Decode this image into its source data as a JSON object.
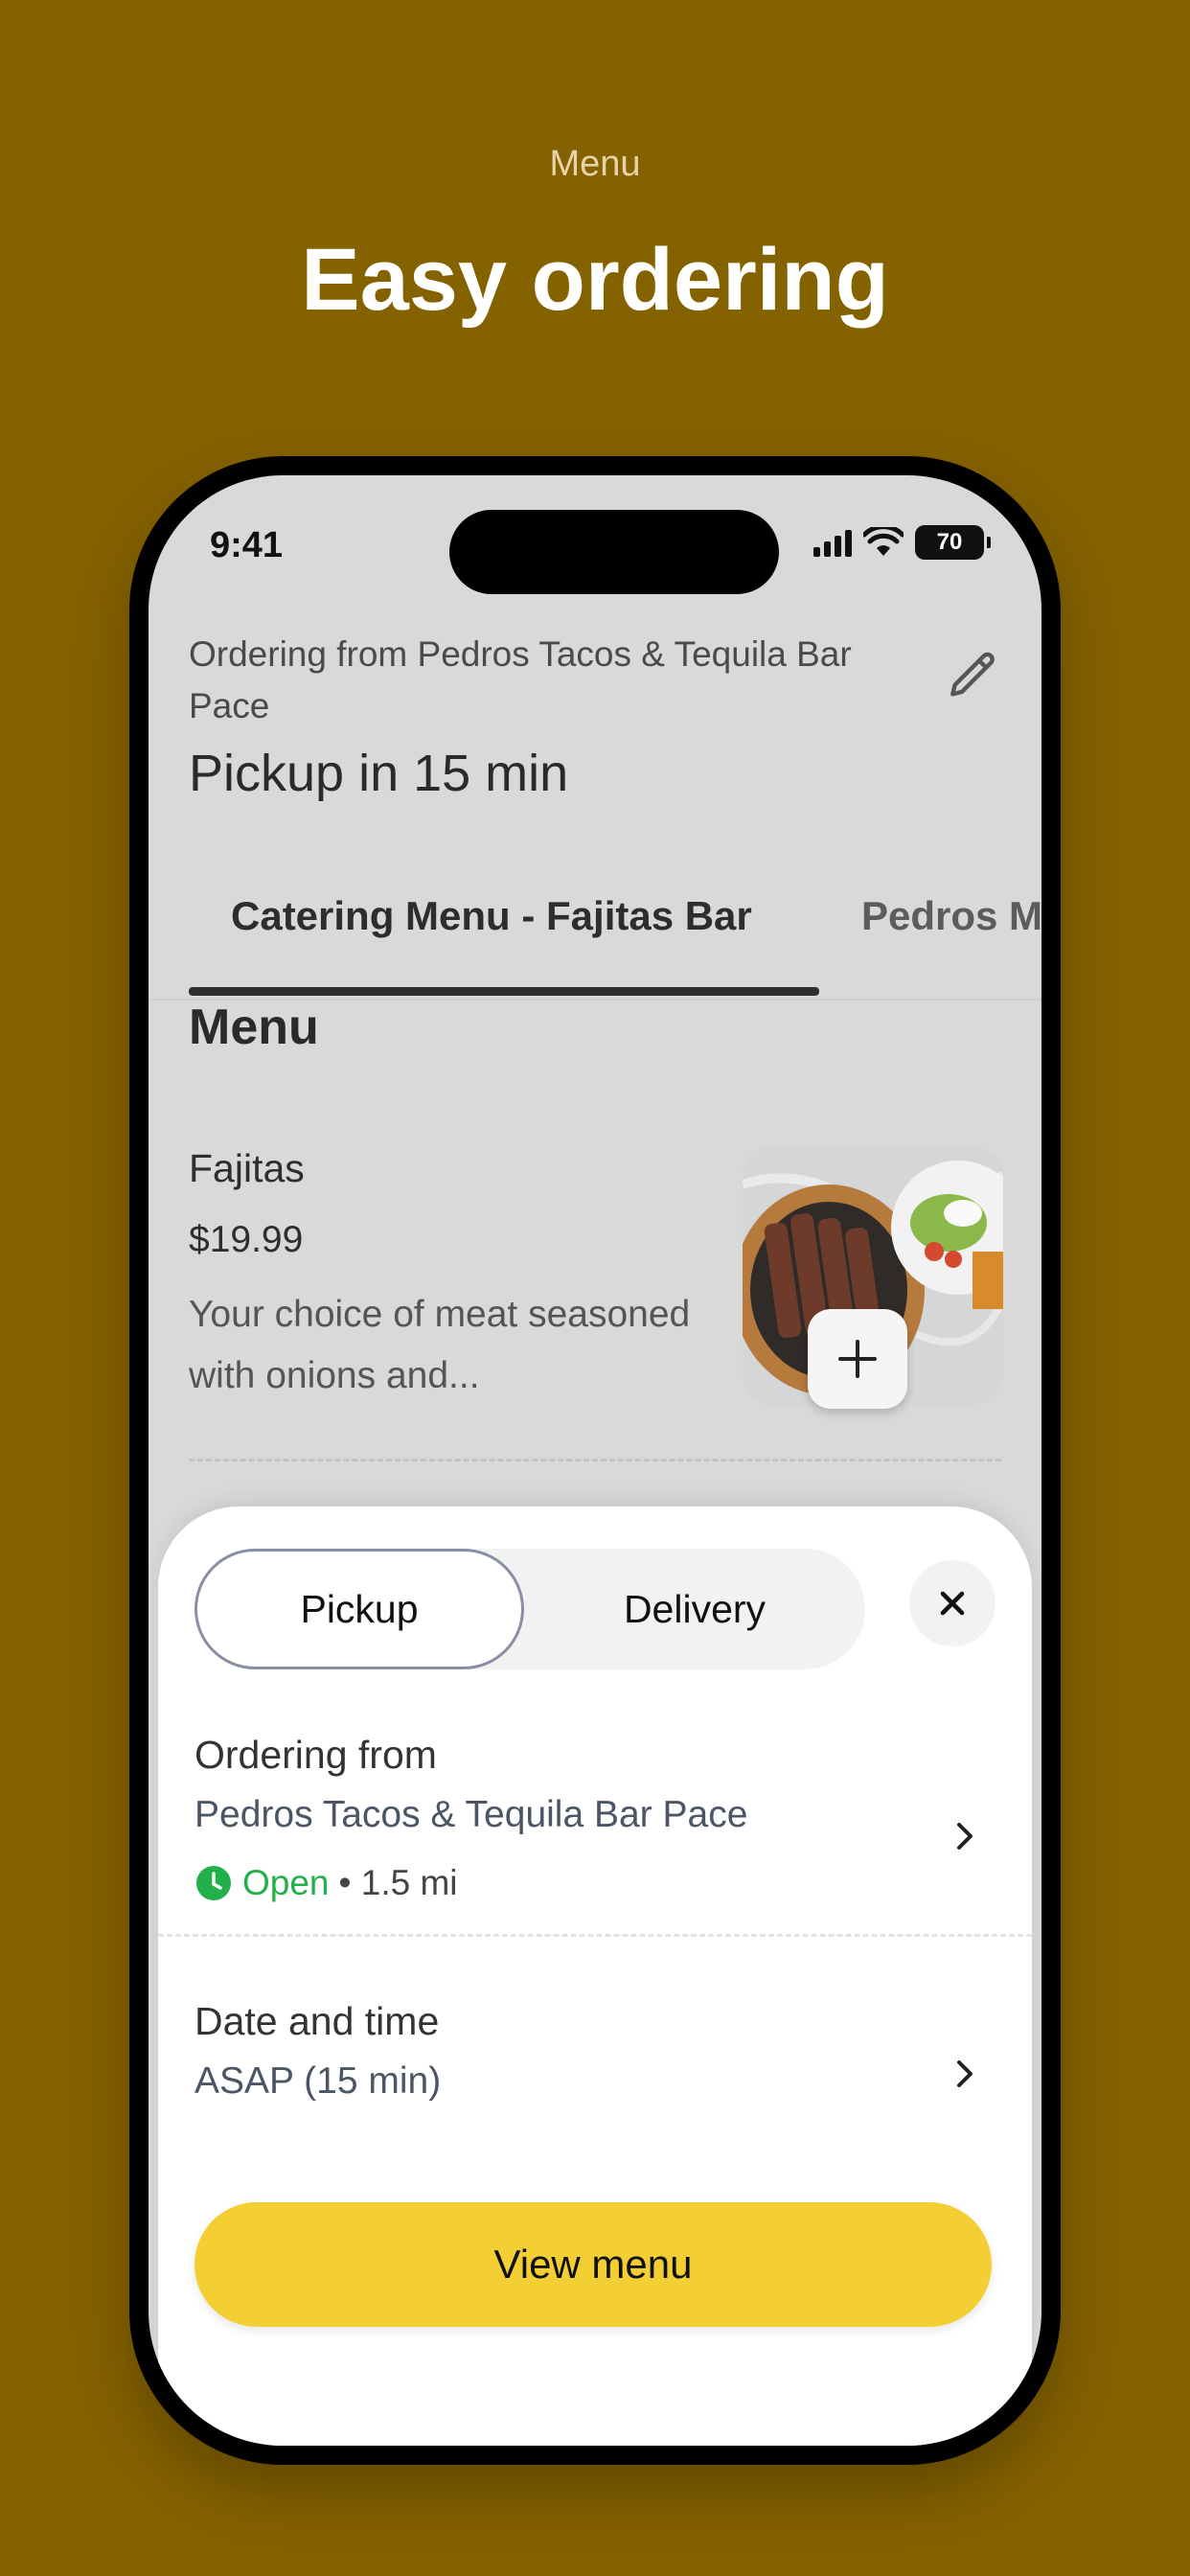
{
  "promo": {
    "subtitle": "Menu",
    "title": "Easy ordering"
  },
  "status_bar": {
    "time": "9:41",
    "battery": "70",
    "icons": [
      "signal-icon",
      "wifi-icon",
      "battery-icon"
    ]
  },
  "header": {
    "ordering_from": "Ordering from Pedros Tacos & Tequila Bar Pace",
    "pickup_time": "Pickup in 15 min",
    "edit_icon": "pencil-icon"
  },
  "tabs": [
    {
      "label": "Catering Menu - Fajitas Bar",
      "selected": true
    },
    {
      "label": "Pedros M",
      "selected": false
    }
  ],
  "menu": {
    "section_title": "Menu",
    "items": [
      {
        "name": "Fajitas",
        "price": "$19.99",
        "description": "Your choice of meat seasoned with onions and..."
      }
    ]
  },
  "sheet": {
    "segments": [
      "Pickup",
      "Delivery"
    ],
    "selected_segment": "Pickup",
    "ordering_from_label": "Ordering from",
    "location": "Pedros Tacos & Tequila Bar Pace",
    "open_status": "Open",
    "distance": "• 1.5 mi",
    "date_time_label": "Date and time",
    "date_time_value": "ASAP (15 min)",
    "cta_label": "View menu"
  },
  "colors": {
    "background": "#856200",
    "accent": "#f3cf33",
    "open_green": "#22b04b"
  }
}
